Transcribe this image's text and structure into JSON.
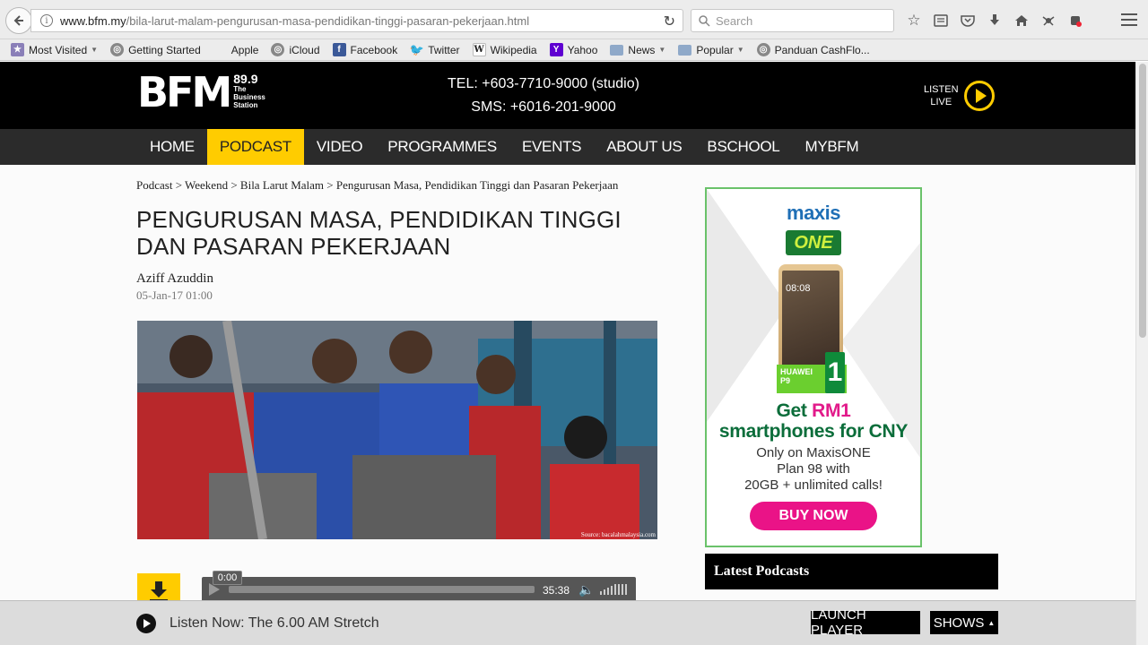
{
  "browser": {
    "url_domain": "www.bfm.my",
    "url_path": "/bila-larut-malam-pengurusan-masa-pendidikan-tinggi-pasaran-pekerjaan.html",
    "search_placeholder": "Search",
    "bookmarks": [
      {
        "label": "Most Visited",
        "icon": "star-folder-icon",
        "dropdown": true
      },
      {
        "label": "Getting Started",
        "icon": "globe-icon",
        "dropdown": false
      },
      {
        "label": "Apple",
        "icon": "apple-icon",
        "dropdown": false
      },
      {
        "label": "iCloud",
        "icon": "globe-icon",
        "dropdown": false
      },
      {
        "label": "Facebook",
        "icon": "facebook-icon",
        "dropdown": false
      },
      {
        "label": "Twitter",
        "icon": "twitter-icon",
        "dropdown": false
      },
      {
        "label": "Wikipedia",
        "icon": "wikipedia-icon",
        "dropdown": false
      },
      {
        "label": "Yahoo",
        "icon": "yahoo-icon",
        "dropdown": false
      },
      {
        "label": "News",
        "icon": "folder-icon",
        "dropdown": true
      },
      {
        "label": "Popular",
        "icon": "folder-icon",
        "dropdown": true
      },
      {
        "label": "Panduan CashFlo...",
        "icon": "globe-icon",
        "dropdown": false
      }
    ]
  },
  "header": {
    "logo_main": "BFM",
    "logo_freq": "89.9",
    "logo_tagline": [
      "The",
      "Business",
      "Station"
    ],
    "tel": "TEL: +603-7710-9000 (studio)",
    "sms": "SMS: +6016-201-9000",
    "listen_line1": "LISTEN",
    "listen_line2": "LIVE"
  },
  "nav": {
    "items": [
      "HOME",
      "PODCAST",
      "VIDEO",
      "PROGRAMMES",
      "EVENTS",
      "ABOUT US",
      "BSCHOOL",
      "MYBFM"
    ],
    "active": "PODCAST",
    "accent_color": "#ffcc00"
  },
  "article": {
    "breadcrumb": "Podcast > Weekend > Bila Larut Malam > Pengurusan Masa, Pendidikan Tinggi dan Pasaran Pekerjaan",
    "title": "PENGURUSAN MASA, PENDIDIKAN TINGGI DAN PASARAN PEKERJAAN",
    "author": "Aziff Azuddin",
    "date": "05-Jan-17 01:00",
    "photo_credit": "Source: bacalahmalaysia.com"
  },
  "player": {
    "current_time": "0:00",
    "duration": "35:38",
    "progress_fraction": 0
  },
  "ad": {
    "brand": "maxis",
    "brand_sub": "ONE",
    "phone_time": "08:08",
    "phone_tag_line1": "HUAWEI",
    "phone_tag_line2": "P9",
    "phone_price_badge": "1",
    "headline_pre": "Get ",
    "headline_rm": "RM1",
    "headline_post": "smartphones for CNY",
    "body_line1": "Only on MaxisONE",
    "body_line2": "Plan 98 with",
    "body_line3": "20GB + unlimited calls!",
    "cta": "BUY NOW"
  },
  "sidebar": {
    "latest_title": "Latest Podcasts"
  },
  "bottom_bar": {
    "listen_now": "Listen Now: The 6.00 AM Stretch",
    "launch_player": "LAUNCH PLAYER",
    "shows": "SHOWS"
  }
}
